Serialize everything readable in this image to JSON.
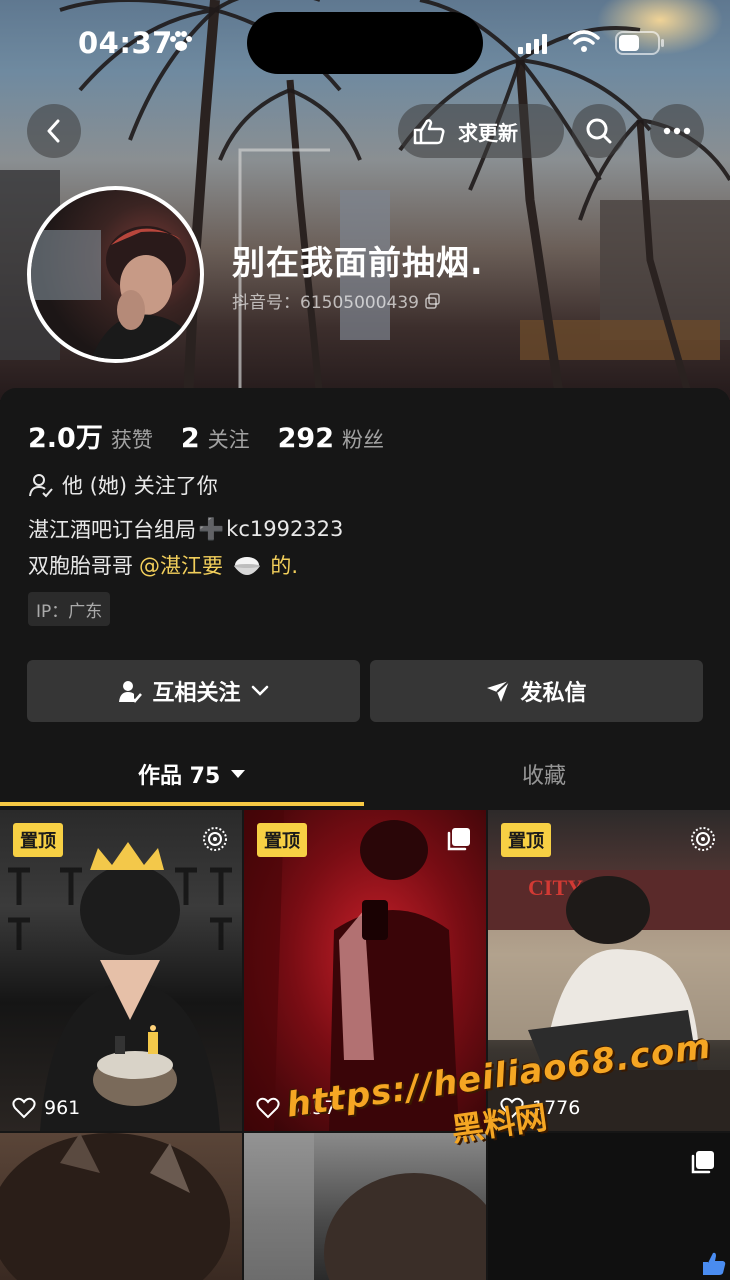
{
  "status_bar": {
    "time": "04:37"
  },
  "header": {
    "update_label": "求更新"
  },
  "profile": {
    "nickname": "别在我面前抽烟.",
    "douyin_id": "抖音号：61505000439"
  },
  "stats": [
    {
      "value": "2.0万",
      "label": "获赞"
    },
    {
      "value": "2",
      "label": "关注"
    },
    {
      "value": "292",
      "label": "粉丝"
    }
  ],
  "follow_note": "他 (她) 关注了你",
  "bio": {
    "line1_prefix": "湛江酒吧订台组局",
    "line1_symbol": "➕",
    "line1_suffix": "kc1992323",
    "line2_prefix": "双胞胎哥哥",
    "mention_prefix": "@湛江要",
    "mention_suffix": "的."
  },
  "ip": "IP：广东",
  "actions": {
    "mutual_label": "互相关注",
    "dm_label": "发私信"
  },
  "tabs": {
    "works_label": "作品 75",
    "favorites_label": "收藏"
  },
  "videos": [
    {
      "pinned": "置顶",
      "likes": "961"
    },
    {
      "pinned": "置顶",
      "likes": "3257"
    },
    {
      "pinned": "置顶",
      "likes": "1776",
      "sign": "CITY"
    }
  ],
  "watermark": {
    "url": "https://heiliao68.com",
    "name": "黑料网"
  },
  "colors": {
    "accent": "#f7c844",
    "mention": "#f2cf5b",
    "panel": "#161616"
  }
}
